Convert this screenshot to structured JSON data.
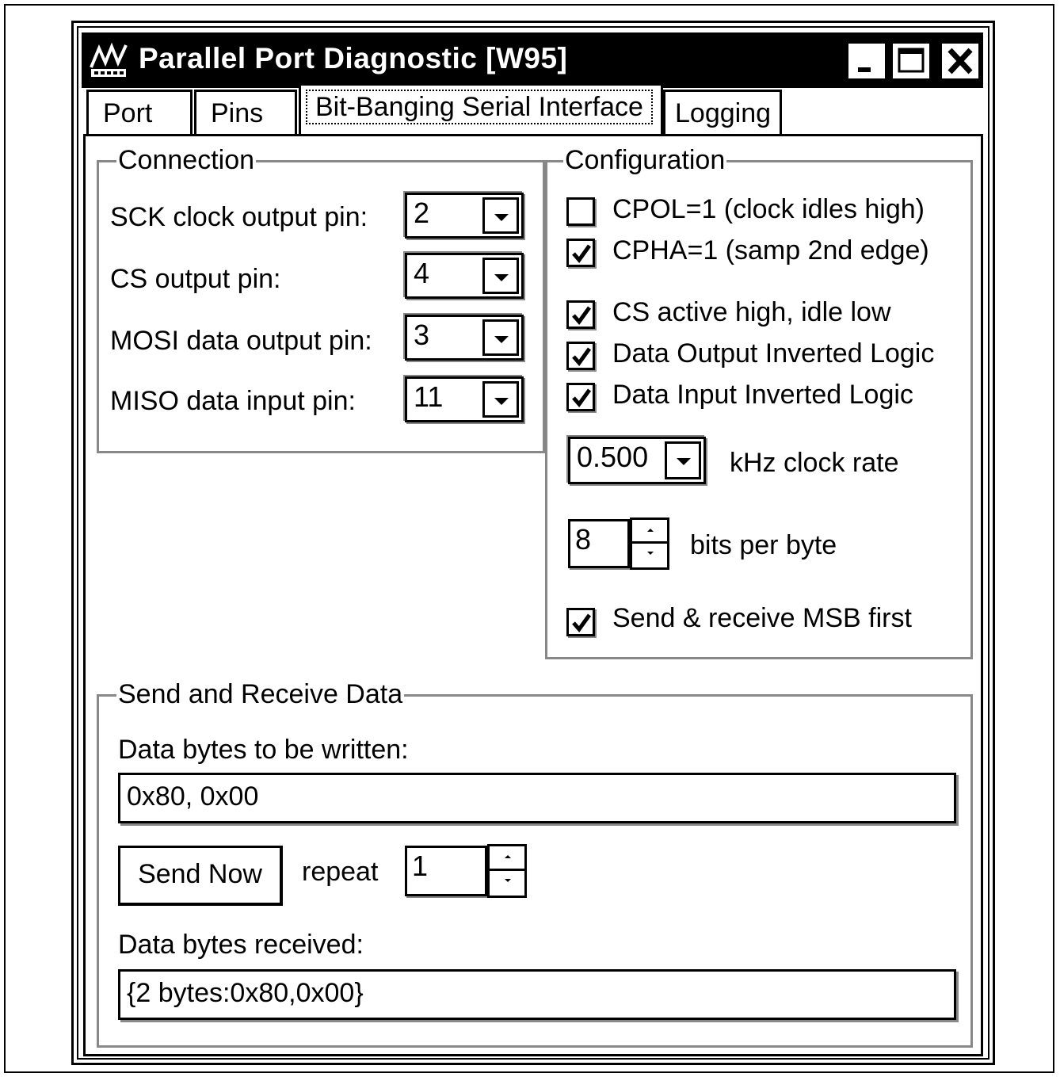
{
  "window": {
    "title": "Parallel Port Diagnostic [W95]"
  },
  "tabs": [
    {
      "label": "Port"
    },
    {
      "label": "Pins"
    },
    {
      "label": "Bit-Banging Serial Interface"
    },
    {
      "label": "Logging"
    }
  ],
  "connection": {
    "legend": "Connection",
    "rows": [
      {
        "label": "SCK clock output pin:",
        "value": "2"
      },
      {
        "label": "CS output pin:",
        "value": "4"
      },
      {
        "label": "MOSI data output pin:",
        "value": "3"
      },
      {
        "label": "MISO data input pin:",
        "value": "11"
      }
    ]
  },
  "configuration": {
    "legend": "Configuration",
    "checks": [
      {
        "label": "CPOL=1 (clock idles high)",
        "checked": false
      },
      {
        "label": "CPHA=1 (samp 2nd edge)",
        "checked": true
      },
      {
        "label": "CS active high, idle low",
        "checked": true
      },
      {
        "label": "Data Output Inverted Logic",
        "checked": true
      },
      {
        "label": "Data Input Inverted Logic",
        "checked": true
      }
    ],
    "clock_rate_value": "0.500",
    "clock_rate_label": "kHz clock rate",
    "bits_value": "8",
    "bits_label": "bits per byte",
    "msb_label": "Send & receive MSB first",
    "msb_checked": true
  },
  "send_receive": {
    "legend": "Send and Receive Data",
    "write_label": "Data bytes to be written:",
    "write_value": "0x80, 0x00",
    "send_button": "Send Now",
    "repeat_label": "repeat",
    "repeat_value": "1",
    "received_label": "Data bytes received:",
    "received_value": "{2 bytes:0x80,0x00}"
  }
}
